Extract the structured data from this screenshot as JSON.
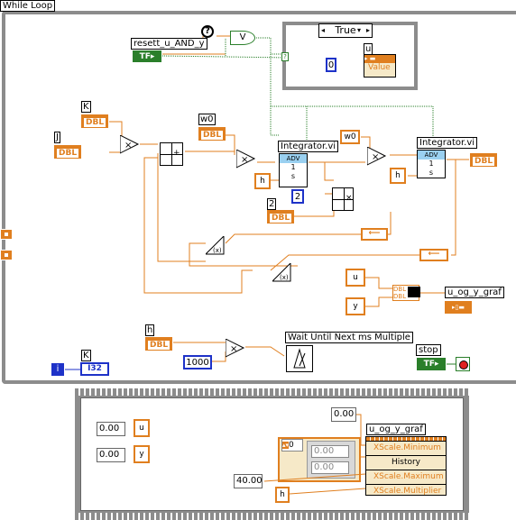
{
  "loop": {
    "label": "While Loop"
  },
  "case": {
    "selector": "True"
  },
  "block": {
    "resett_label": "resett_u_AND_y",
    "tf": "TF",
    "u_label": "u",
    "value_label": "Value",
    "zero": "0",
    "K_label": "K",
    "J_label": "J",
    "w0_label": "w0",
    "w0_const": "w0",
    "dbl": "DBL",
    "integrator1": "Integrator.vi",
    "integrator2": "Integrator.vi",
    "adv": "ADV",
    "h_const": "h",
    "h_label": "h",
    "two_label": "2",
    "two_value": "2",
    "u_const": "u",
    "y_const": "y",
    "u_og_y_graf": "u_og_y_graf",
    "wait_label": "Wait Until Next ms Multiple",
    "thousand": "1000",
    "i": "i",
    "i32": "I32",
    "K2_label": "K",
    "stop_label": "stop",
    "question": "?"
  },
  "seq": {
    "u_val": "0.00",
    "u_name": "u",
    "y_val": "0.00",
    "y_name": "y",
    "top_val": "0.00",
    "graph_label": "u_og_y_graf",
    "prop1": "XScale.Minimum",
    "prop2": "History",
    "prop3": "XScale.Maximum",
    "prop4": "XScale.Multiplier",
    "forty": "40.00",
    "h_name": "h",
    "index": "0",
    "arr1": "0.00",
    "arr2": "0.00"
  },
  "colors": {
    "orange": "#e07f1f",
    "gray": "#8c8c8c",
    "green": "#2a7f2a",
    "blue": "#1e32c8"
  }
}
